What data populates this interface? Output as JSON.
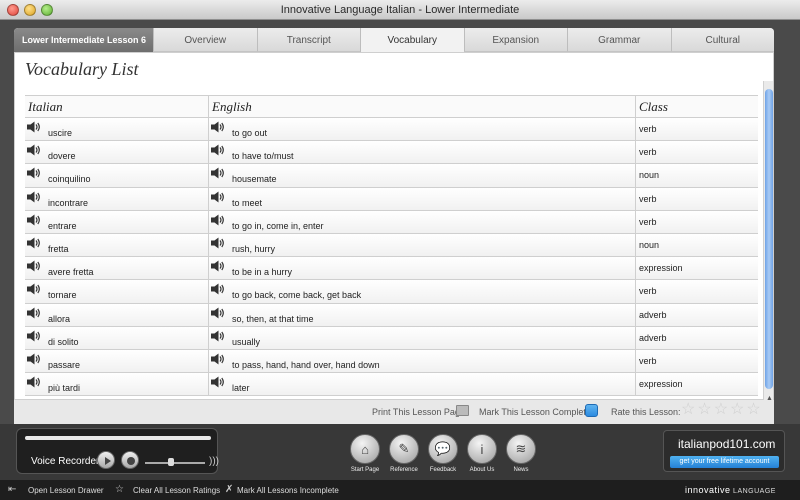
{
  "window": {
    "title": "Innovative Language Italian - Lower Intermediate"
  },
  "tabs": {
    "lesson": "Lower Intermediate Lesson 6",
    "items": [
      "Overview",
      "Transcript",
      "Vocabulary",
      "Expansion",
      "Grammar",
      "Cultural"
    ],
    "active": "Vocabulary"
  },
  "vocab": {
    "heading": "Vocabulary List",
    "headers": [
      "Italian",
      "English",
      "Class"
    ],
    "rows": [
      {
        "it": "uscire",
        "en": "to go out",
        "cls": "verb"
      },
      {
        "it": "dovere",
        "en": "to have to/must",
        "cls": "verb"
      },
      {
        "it": "coinquilino",
        "en": "housemate",
        "cls": "noun"
      },
      {
        "it": "incontrare",
        "en": "to meet",
        "cls": "verb"
      },
      {
        "it": "entrare",
        "en": "to go in, come in, enter",
        "cls": "verb"
      },
      {
        "it": "fretta",
        "en": "rush, hurry",
        "cls": "noun"
      },
      {
        "it": "avere fretta",
        "en": "to be in a hurry",
        "cls": "expression"
      },
      {
        "it": "tornare",
        "en": "to go back, come back, get back",
        "cls": "verb"
      },
      {
        "it": "allora",
        "en": "so, then, at that time",
        "cls": "adverb"
      },
      {
        "it": "di solito",
        "en": "usually",
        "cls": "adverb"
      },
      {
        "it": "passare",
        "en": "to pass, hand, hand over, hand down",
        "cls": "verb"
      },
      {
        "it": "più tardi",
        "en": "later",
        "cls": "expression"
      }
    ]
  },
  "footer": {
    "print": "Print This Lesson Page",
    "mark": "Mark This Lesson Complete",
    "rate": "Rate this Lesson:",
    "stars": 5
  },
  "recorder": {
    "label": "Voice Recorder"
  },
  "nav": [
    {
      "label": "Start Page",
      "icon": "home-icon",
      "glyph": "⌂"
    },
    {
      "label": "Reference",
      "icon": "reference-icon",
      "glyph": "✎"
    },
    {
      "label": "Feedback",
      "icon": "feedback-icon",
      "glyph": "💬"
    },
    {
      "label": "About Us",
      "icon": "info-icon",
      "glyph": "i"
    },
    {
      "label": "News",
      "icon": "rss-icon",
      "glyph": "≋"
    }
  ],
  "promo": {
    "logo": "italianpod101.com",
    "cta": "get your free lifetime account"
  },
  "statusbar": {
    "open_drawer": "Open Lesson Drawer",
    "clear_ratings": "Clear All Lesson Ratings",
    "mark_incomplete": "Mark All Lessons Incomplete",
    "brand": "innovative",
    "brand_suffix": "LANGUAGE"
  },
  "colors": {
    "accent": "#2d8be0",
    "thumb": "#6fa3e6"
  }
}
